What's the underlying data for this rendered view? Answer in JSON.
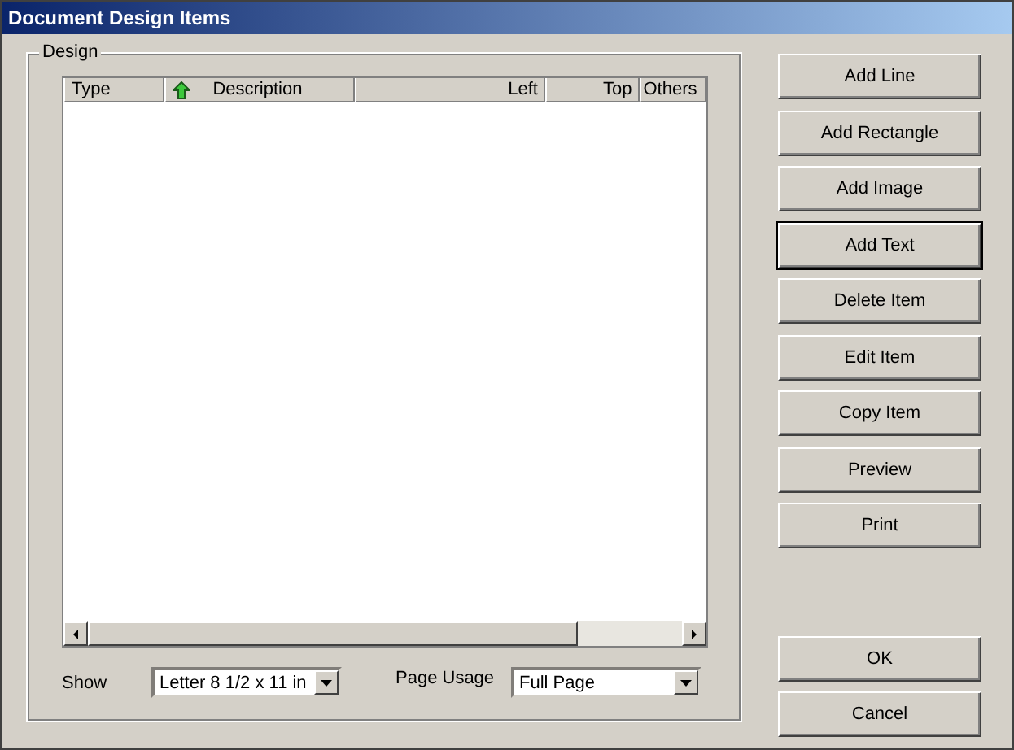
{
  "window": {
    "title": "Document Design Items"
  },
  "design_group": {
    "label": "Design",
    "table": {
      "columns": [
        {
          "label": "Type",
          "sorted": false
        },
        {
          "label": "Description",
          "sorted": true
        },
        {
          "label": "Left",
          "sorted": false
        },
        {
          "label": "Top",
          "sorted": false
        },
        {
          "label": "Others",
          "sorted": false
        }
      ]
    },
    "show": {
      "label": "Show",
      "value": "Letter 8 1/2 x 11 in"
    },
    "page_usage": {
      "label": "Page Usage",
      "value": "Full Page"
    }
  },
  "buttons": [
    {
      "label": "Add Line",
      "focused": false
    },
    {
      "label": "Add Rectangle",
      "focused": false
    },
    {
      "label": "Add Image",
      "focused": false
    },
    {
      "label": "Add Text",
      "focused": true
    },
    {
      "label": "Delete Item",
      "focused": false
    },
    {
      "label": "Edit Item",
      "focused": false
    },
    {
      "label": "Copy Item",
      "focused": false
    },
    {
      "label": "Preview",
      "focused": false
    },
    {
      "label": "Print",
      "focused": false
    }
  ],
  "dialog_buttons": [
    {
      "label": "OK",
      "focused": false
    },
    {
      "label": "Cancel",
      "focused": false
    }
  ]
}
